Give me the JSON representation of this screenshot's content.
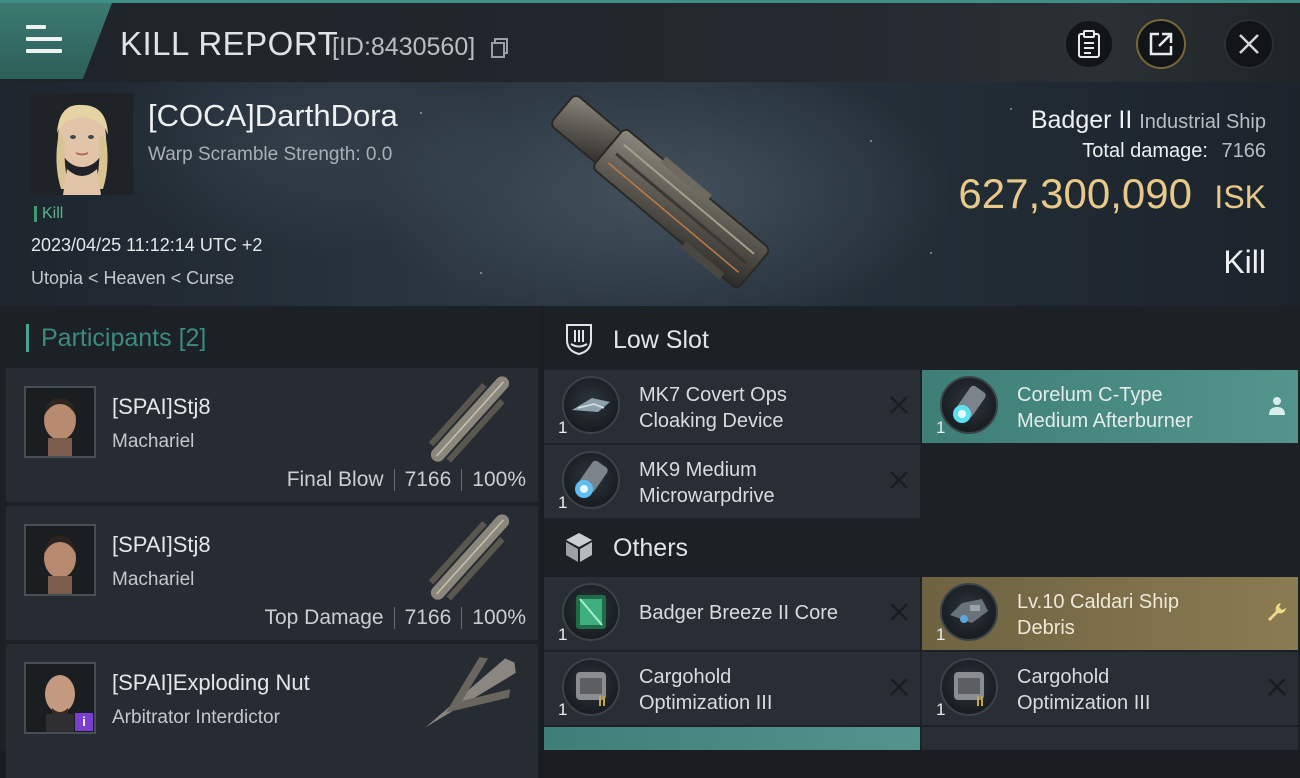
{
  "header": {
    "title": "KILL REPORT",
    "report_id": "[ID:8430560]"
  },
  "victim": {
    "name": "[COCA]DarthDora",
    "warp_scramble": "Warp Scramble Strength: 0.0",
    "tag": "Kill",
    "datetime": "2023/04/25 11:12:14 UTC +2",
    "location": "Utopia < Heaven < Curse",
    "ship_name": "Badger II",
    "ship_class": "Industrial Ship",
    "total_damage_label": "Total damage:",
    "total_damage_value": "7166",
    "isk_value": "627,300,090",
    "isk_unit": "ISK",
    "result": "Kill"
  },
  "participants": {
    "heading": "Participants",
    "count": "[2]",
    "rows": [
      {
        "name": "[SPAI]Stj8",
        "ship": "Machariel",
        "role": "Final Blow",
        "damage": "7166",
        "percent": "100%"
      },
      {
        "name": "[SPAI]Stj8",
        "ship": "Machariel",
        "role": "Top Damage",
        "damage": "7166",
        "percent": "100%"
      },
      {
        "name": "[SPAI]Exploding Nut",
        "ship": "Arbitrator Interdictor",
        "badge": "i"
      }
    ]
  },
  "sections": {
    "low_slot": "Low Slot",
    "others": "Others"
  },
  "modules": {
    "low_slot": [
      {
        "qty": "1",
        "line1": "MK7 Covert Ops",
        "line2": "Cloaking Device",
        "status": "destroyed"
      },
      {
        "qty": "1",
        "line1": "Corelum C-Type",
        "line2": "Medium Afterburner",
        "status": "dropped"
      },
      {
        "qty": "1",
        "line1": "MK9 Medium",
        "line2": "Microwarpdrive",
        "status": "destroyed"
      }
    ],
    "others": [
      {
        "qty": "1",
        "line1": "Badger Breeze II Core",
        "line2": "",
        "status": "destroyed"
      },
      {
        "qty": "1",
        "line1": "Lv.10 Caldari Ship",
        "line2": "Debris",
        "status": "salvage"
      },
      {
        "qty": "1",
        "line1": "Cargohold",
        "line2": "Optimization III",
        "status": "destroyed"
      },
      {
        "qty": "1",
        "line1": "Cargohold",
        "line2": "Optimization III",
        "status": "destroyed"
      }
    ]
  },
  "icons": {
    "menu": "hamburger-icon",
    "copy": "copy-icon",
    "clipboard": "clipboard-icon",
    "export": "export-icon",
    "close": "close-icon",
    "low_slot": "low-slot-icon",
    "others": "cube-icon",
    "destroyed": "x-icon",
    "dropped": "person-icon",
    "salvage": "wrench-icon"
  },
  "colors": {
    "accent_teal": "#3f8f86",
    "isk_gold": "#e8c98a",
    "dropped_bg": "#53958c",
    "salvage_bg": "#8a7b52"
  }
}
